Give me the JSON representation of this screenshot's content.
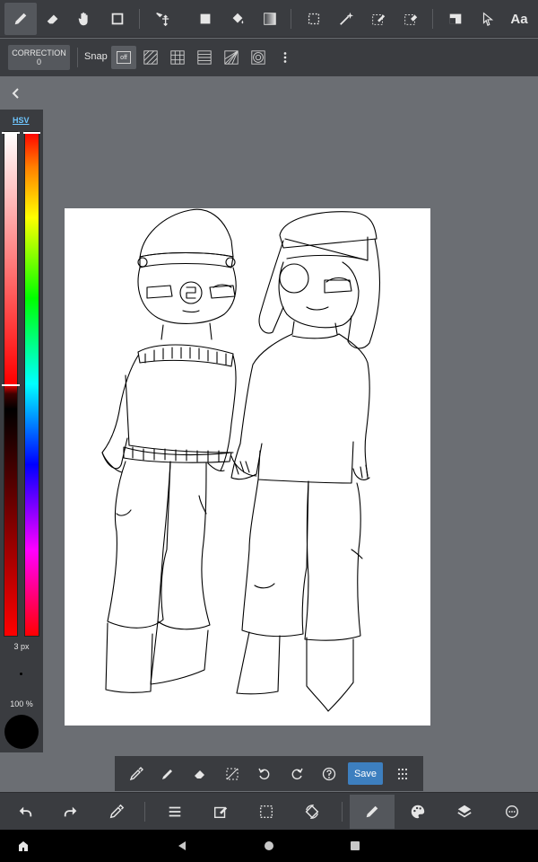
{
  "toolbar": {
    "tools": [
      "pen-icon",
      "eraser-icon",
      "hand-icon",
      "rect-shape-icon",
      "transform-icon",
      "fill-rect-icon",
      "bucket-icon",
      "gradient-icon",
      "select-rect-icon",
      "magic-wand-icon",
      "select-pen-icon",
      "select-eraser-icon",
      "layer-fill-icon",
      "cursor-icon",
      "text-icon"
    ],
    "text_tool_label": "Aa"
  },
  "subbar": {
    "correction_label": "CORRECTION",
    "correction_value": "0",
    "snap_label": "Snap",
    "snap_off_label": "off"
  },
  "color_panel": {
    "mode_label": "HSV",
    "brush_size": "3 px",
    "opacity": "100 %",
    "current_color": "#000000"
  },
  "floating_bar": {
    "save_label": "Save"
  },
  "colors": {
    "toolbar_bg": "#3a3c40",
    "workspace_bg": "#6b6e73",
    "accent": "#3d7fbf",
    "hsv_link": "#6ec6ff"
  }
}
